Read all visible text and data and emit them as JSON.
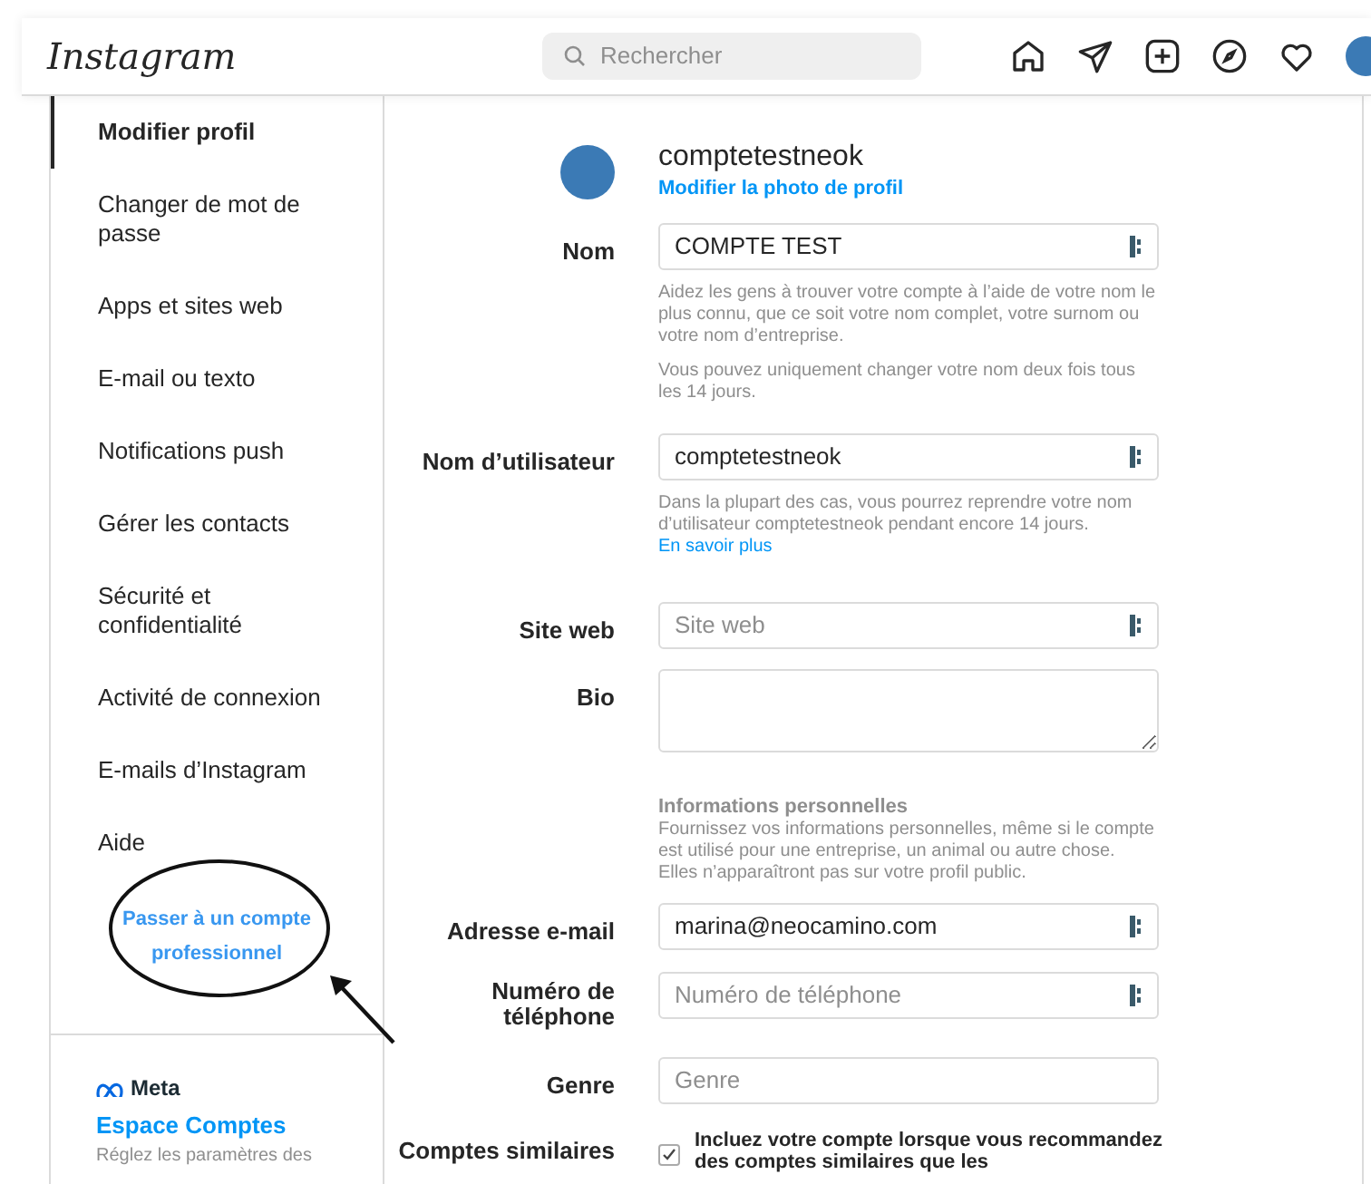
{
  "header": {
    "logo": "Instagram",
    "search": {
      "placeholder": "Rechercher"
    }
  },
  "sidebar": {
    "items": [
      {
        "label": "Modifier profil",
        "selected": true
      },
      {
        "label": "Changer de mot de passe",
        "selected": false
      },
      {
        "label": "Apps et sites web",
        "selected": false
      },
      {
        "label": "E-mail ou texto",
        "selected": false
      },
      {
        "label": "Notifications push",
        "selected": false
      },
      {
        "label": "Gérer les contacts",
        "selected": false
      },
      {
        "label": "Sécurité et confidentialité",
        "selected": false
      },
      {
        "label": "Activité de connexion",
        "selected": false
      },
      {
        "label": "E-mails d’Instagram",
        "selected": false
      },
      {
        "label": "Aide",
        "selected": false
      }
    ],
    "pro_link": "Passer à un compte professionnel",
    "meta": {
      "brand": "Meta",
      "title": "Espace Comptes",
      "description": "Réglez les paramètres des"
    }
  },
  "profile": {
    "username": "comptetestneok",
    "change_photo": "Modifier la photo de profil"
  },
  "fields": [
    {
      "kind": "input",
      "label": "Nom",
      "value": "COMPTE TEST",
      "autofill_icon": true,
      "help": [
        "Aidez les gens à trouver votre compte à l’aide de votre nom le plus connu, que ce soit votre nom complet, votre surnom ou votre nom d’entreprise.",
        "Vous pouvez uniquement changer votre nom deux fois tous les 14 jours."
      ]
    },
    {
      "kind": "input",
      "label": "Nom d’utilisateur",
      "value": "comptetestneok",
      "autofill_icon": true,
      "help": [
        "Dans la plupart des cas, vous pourrez reprendre votre nom d’utilisateur comptetestneok pendant encore 14 jours."
      ],
      "link": "En savoir plus"
    },
    {
      "kind": "input",
      "label": "Site web",
      "placeholder": "Site web",
      "autofill_icon": true
    },
    {
      "kind": "textarea",
      "label": "Bio"
    },
    {
      "kind": "section",
      "title": "Informations personnelles",
      "help": [
        "Fournissez vos informations personnelles, même si le compte est utilisé pour une entreprise, un animal ou autre chose. Elles n’apparaîtront pas sur votre profil public."
      ]
    },
    {
      "kind": "input",
      "label": "Adresse e-mail",
      "value": "marina@neocamino.com",
      "autofill_icon": true
    },
    {
      "kind": "input",
      "label": "Numéro de téléphone",
      "placeholder": "Numéro de téléphone",
      "autofill_icon": true
    },
    {
      "kind": "input",
      "label": "Genre",
      "placeholder": "Genre",
      "autofill_icon": false
    },
    {
      "kind": "checkbox",
      "label": "Comptes similaires",
      "text": "Incluez votre compte lorsque vous recommandez des comptes similaires que les",
      "checked": true
    }
  ]
}
